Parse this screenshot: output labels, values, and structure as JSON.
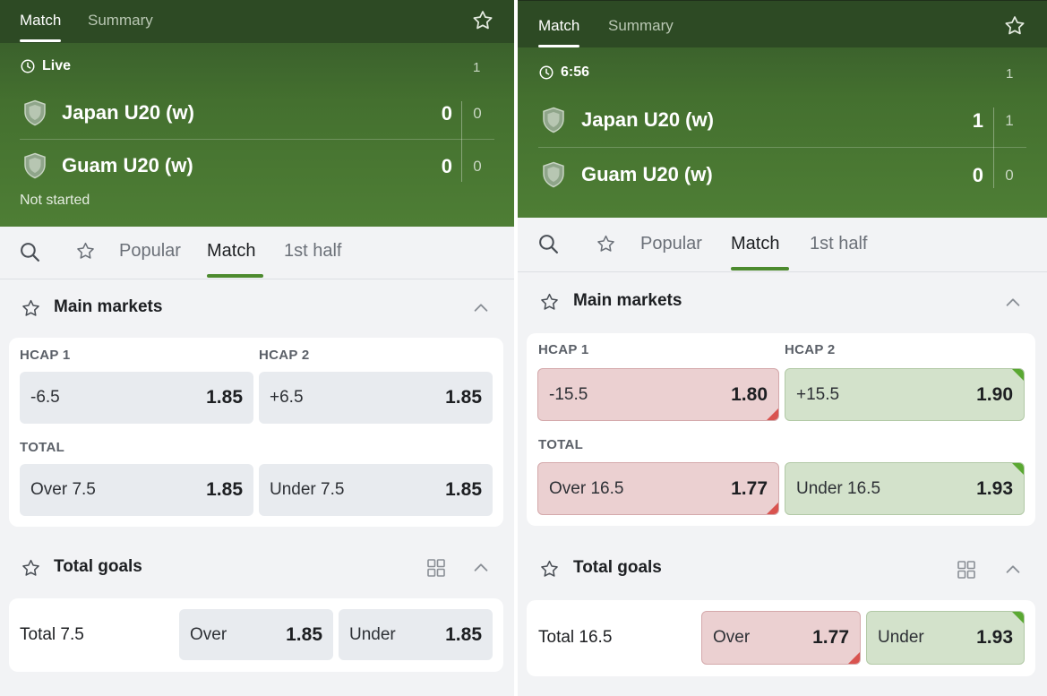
{
  "left": {
    "tabs": [
      "Match",
      "Summary"
    ],
    "status": {
      "label": "Live",
      "period": "1"
    },
    "teams": [
      {
        "name": "Japan U20 (w)",
        "score": "0",
        "period_score": "0"
      },
      {
        "name": "Guam U20 (w)",
        "score": "0",
        "period_score": "0"
      }
    ],
    "footer_status": "Not started",
    "subtabs": [
      "Popular",
      "Match",
      "1st half"
    ],
    "main_markets": {
      "title": "Main markets",
      "hcap1_label": "HCAP 1",
      "hcap2_label": "HCAP 2",
      "hcap1": {
        "label": "-6.5",
        "odds": "1.85"
      },
      "hcap2": {
        "label": "+6.5",
        "odds": "1.85"
      },
      "total_label": "TOTAL",
      "over": {
        "label": "Over 7.5",
        "odds": "1.85"
      },
      "under": {
        "label": "Under 7.5",
        "odds": "1.85"
      }
    },
    "total_goals": {
      "title": "Total goals",
      "line": "Total 7.5",
      "over": {
        "label": "Over",
        "odds": "1.85"
      },
      "under": {
        "label": "Under",
        "odds": "1.85"
      }
    }
  },
  "right": {
    "tabs": [
      "Match",
      "Summary"
    ],
    "status": {
      "label": "6:56",
      "period": "1"
    },
    "teams": [
      {
        "name": "Japan U20 (w)",
        "score": "1",
        "period_score": "1"
      },
      {
        "name": "Guam U20 (w)",
        "score": "0",
        "period_score": "0"
      }
    ],
    "subtabs": [
      "Popular",
      "Match",
      "1st half"
    ],
    "main_markets": {
      "title": "Main markets",
      "hcap1_label": "HCAP 1",
      "hcap2_label": "HCAP 2",
      "hcap1": {
        "label": "-15.5",
        "odds": "1.80",
        "trend": "down"
      },
      "hcap2": {
        "label": "+15.5",
        "odds": "1.90",
        "trend": "up"
      },
      "total_label": "TOTAL",
      "over": {
        "label": "Over 16.5",
        "odds": "1.77",
        "trend": "down"
      },
      "under": {
        "label": "Under 16.5",
        "odds": "1.93",
        "trend": "up"
      }
    },
    "total_goals": {
      "title": "Total goals",
      "line": "Total 16.5",
      "over": {
        "label": "Over",
        "odds": "1.77",
        "trend": "down"
      },
      "under": {
        "label": "Under",
        "odds": "1.93",
        "trend": "up"
      }
    }
  },
  "colors": {
    "header_green": "#44702f",
    "tab_accent": "#4c8a2e",
    "odds_down": "#ebd0d1",
    "odds_up": "#d3e2cb",
    "arrow_down": "#d9534f",
    "arrow_up": "#5aa832"
  },
  "icons": [
    "star-icon",
    "clock-icon",
    "shield-icon",
    "search-icon",
    "chevron-up-icon",
    "grid-icon"
  ]
}
